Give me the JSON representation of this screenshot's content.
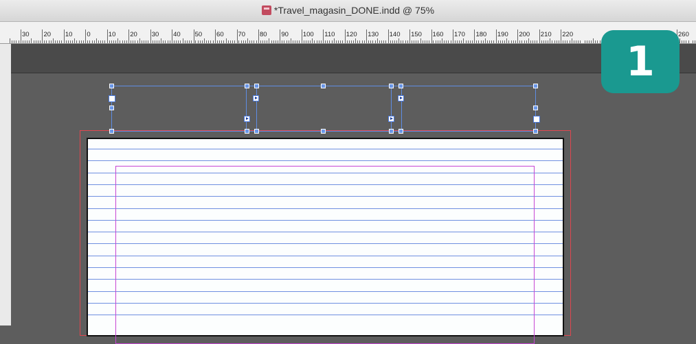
{
  "window": {
    "title": "*Travel_magasin_DONE.indd @ 75%",
    "doc_icon": "indesign-document-icon"
  },
  "ruler": {
    "labels": [
      "30",
      "20",
      "10",
      "0",
      "10",
      "20",
      "30",
      "40",
      "50",
      "60",
      "70",
      "80",
      "90",
      "100",
      "110",
      "120",
      "130",
      "140",
      "150",
      "160",
      "170",
      "180",
      "190",
      "200",
      "210",
      "220",
      "260"
    ]
  },
  "text_frames": {
    "count": 3,
    "threaded": true,
    "port_icon": "text-thread-port-icon"
  },
  "step_badge": {
    "number": "1",
    "color": "#1a9990"
  },
  "colors": {
    "bleed": "#e0474f",
    "margin": "#c644d4",
    "baseline_grid": "#6e8fe0",
    "selection": "#5f8ee6"
  }
}
